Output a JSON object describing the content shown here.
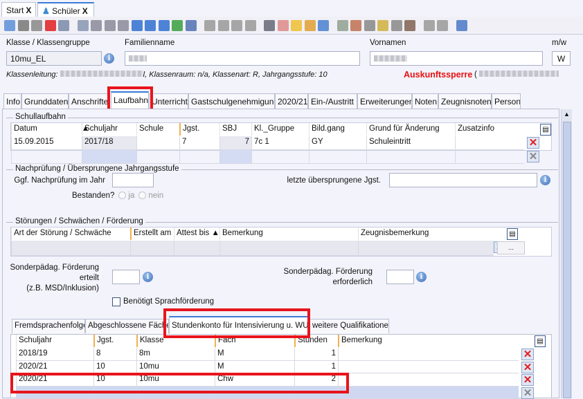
{
  "window_tabs": [
    {
      "label": "Start",
      "close": "X"
    },
    {
      "label": "Schüler",
      "close": "X",
      "icon": "students-icon"
    }
  ],
  "toolbar_icons": [
    "new-icon",
    "save-icon",
    "undo-icon",
    "delete-icon",
    "form-icon",
    "copy-form-icon",
    "first-icon",
    "prev-fast-icon",
    "prev-icon",
    "next-icon",
    "next-fast-icon",
    "last-icon",
    "refresh-icon",
    "list-icon",
    "back-icon",
    "cut-icon",
    "copy-icon",
    "paste-icon",
    "print-icon",
    "view-icon",
    "idea-icon",
    "bell-icon",
    "alarm-icon",
    "export-icon",
    "user-icon",
    "import-icon",
    "folder-icon",
    "book-icon",
    "contact-icon",
    "flag-icon",
    "flag2-icon",
    "help-icon"
  ],
  "header": {
    "klasse_label": "Klasse / Klassengruppe",
    "klasse_value": "10mu_EL",
    "familienname_label": "Familienname",
    "vornamen_label": "Vornamen",
    "mw_label": "m/w",
    "mw_value": "W",
    "info_prefix": "Klassenleitung:",
    "info_suffix": "l, Klassenraum: n/a, Klassenart: R, Jahrgangsstufe: 10",
    "auskunftssperre": "Auskunftssperre",
    "auskunft_paren": "("
  },
  "main_tabs": [
    "Info",
    "Grunddaten",
    "Anschriften",
    "Laufbahn",
    "Unterricht",
    "Gastschulgenehmigung",
    "2020/21",
    "Ein-/Austritt",
    "Erweiterungen",
    "Noten",
    "Zeugnisnoten",
    "Person"
  ],
  "schullaufbahn": {
    "title": "Schullaufbahn",
    "columns": [
      "Datum",
      "Schuljahr",
      "Schule",
      "Jgst.",
      "SBJ",
      "Kl._Gruppe",
      "Bild.gang",
      "Grund für Änderung",
      "Zusatzinfo"
    ],
    "rows": [
      [
        "15.09.2015",
        "2017/18",
        "",
        "7",
        "7",
        "7c 1",
        "GY",
        "Schuleintritt",
        ""
      ]
    ]
  },
  "nachpruefung": {
    "title": "Nachprüfung / Übersprungene Jahrgangsstufe",
    "nachpruefung_label": "Ggf. Nachprüfung im Jahr",
    "letzte_label": "letzte übersprungene Jgst.",
    "bestanden_label": "Bestanden?",
    "ja": "ja",
    "nein": "nein"
  },
  "stoerungen": {
    "title": "Störungen / Schwächen / Förderung",
    "columns": [
      "Art der Störung / Schwäche",
      "Erstellt am",
      "Attest bis",
      "Bemerkung",
      "Zeugnisbemerkung"
    ],
    "ellipsis": "...",
    "erteilt_lines": [
      "Sonderpädag. Förderung",
      "erteilt",
      "(z.B. MSD/Inklusion)"
    ],
    "erforderlich_lines": [
      "Sonderpädag. Förderung",
      "erforderlich"
    ],
    "sprach_label": "Benötigt Sprachförderung",
    "sprach_checked": false
  },
  "sub_tabs": [
    "Fremdsprachenfolge",
    "Abgeschlossene Fächer",
    "Stundenkonto für Intensivierung u. WU",
    "weitere Qualifikationen"
  ],
  "stundenkonto": {
    "columns": [
      "Schuljahr",
      "Jgst.",
      "Klasse",
      "Fach",
      "Stunden",
      "Bemerkung"
    ],
    "rows": [
      [
        "2018/19",
        "8",
        "8m",
        "M",
        "1",
        ""
      ],
      [
        "2020/21",
        "10",
        "10mu",
        "M",
        "1",
        ""
      ],
      [
        "2020/21",
        "10",
        "10mu",
        "Chw",
        "2",
        ""
      ]
    ]
  },
  "colors": {
    "highlight": "#e8141c",
    "accent": "#3b7bd6",
    "warning": "#e81010"
  }
}
